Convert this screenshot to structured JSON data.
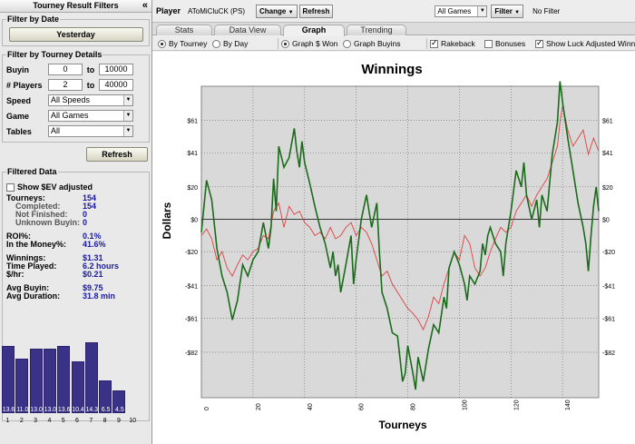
{
  "left": {
    "title": "Tourney Result Filters",
    "collapse_icon": "«",
    "filter_by_date": {
      "legend": "Filter by Date",
      "button": "Yesterday"
    },
    "filter_by_details": {
      "legend": "Filter by Tourney Details",
      "buyin": {
        "label": "Buyin",
        "from": "0",
        "to_word": "to",
        "to": "10000"
      },
      "players": {
        "label": "# Players",
        "from": "2",
        "to_word": "to",
        "to": "40000"
      },
      "speed": {
        "label": "Speed",
        "value": "All Speeds"
      },
      "game": {
        "label": "Game",
        "value": "All Games"
      },
      "tables": {
        "label": "Tables",
        "value": "All"
      }
    },
    "refresh_button": "Refresh",
    "filtered": {
      "legend": "Filtered Data",
      "show_sev": "Show $EV adjusted",
      "tourneys": {
        "label": "Tourneys:",
        "value": "154"
      },
      "completed": {
        "label": "Completed:",
        "value": "154"
      },
      "not_finished": {
        "label": "Not Finished:",
        "value": "0"
      },
      "unknown_buyin": {
        "label": "Unknown Buyin:",
        "value": "0"
      },
      "roi": {
        "label": "ROI%:",
        "value": "0.1%"
      },
      "itm": {
        "label": "In the Money%:",
        "value": "41.6%"
      },
      "winnings": {
        "label": "Winnings:",
        "value": "$1.31"
      },
      "time_played": {
        "label": "Time Played:",
        "value": "6.2 hours"
      },
      "per_hr": {
        "label": "$/hr:",
        "value": "$0.21"
      },
      "avg_buyin": {
        "label": "Avg Buyin:",
        "value": "$9.75"
      },
      "avg_duration": {
        "label": "Avg Duration:",
        "value": "31.8 min"
      }
    },
    "histogram": {
      "values": [
        13.6,
        11.0,
        13.0,
        13.0,
        13.6,
        10.4,
        14.3,
        6.5,
        4.5
      ],
      "labels": [
        "13.6",
        "11.0",
        "13.0",
        "13.0",
        "13.6",
        "10.4",
        "14.3",
        "6.5",
        "4.5"
      ],
      "x_ticks": [
        "1",
        "2",
        "3",
        "4",
        "5",
        "6",
        "7",
        "8",
        "9",
        "10"
      ],
      "bar_color": "#3a3286"
    }
  },
  "toolbar": {
    "player_label": "Player",
    "player_name": "AToMiCluCK (PS)",
    "change_button": "Change",
    "refresh_button": "Refresh",
    "games_select": "All Games",
    "filter_button": "Filter",
    "filter_status": "No Filter"
  },
  "tabs": [
    "Stats",
    "Data View",
    "Graph",
    "Trending"
  ],
  "options": {
    "by_tourney": "By Tourney",
    "by_day": "By Day",
    "graph_won": "Graph $ Won",
    "graph_buyins": "Graph Buyins",
    "rakeback": "Rakeback",
    "bonuses": "Bonuses",
    "show_luck": "Show Luck Adjusted Winn"
  },
  "chart_data": {
    "type": "line",
    "title": "Winnings",
    "xlabel": "Tourneys",
    "ylabel": "Dollars",
    "xlim": [
      0,
      154
    ],
    "ylim": [
      -110,
      82
    ],
    "x_ticks": [
      0,
      20,
      40,
      60,
      80,
      100,
      120,
      140
    ],
    "y_ticks": [
      61,
      41,
      20,
      0,
      -20,
      -41,
      -61,
      -82
    ],
    "y_tick_labels": [
      "$61",
      "$41",
      "$20",
      "$0",
      "-$20",
      "-$41",
      "-$61",
      "-$82"
    ],
    "grid": true,
    "series": [
      {
        "color": "#1a6b1a",
        "points": [
          [
            0,
            -8
          ],
          [
            2,
            24
          ],
          [
            4,
            12
          ],
          [
            6,
            -18
          ],
          [
            8,
            -35
          ],
          [
            10,
            -45
          ],
          [
            12,
            -62
          ],
          [
            14,
            -50
          ],
          [
            16,
            -28
          ],
          [
            18,
            -35
          ],
          [
            20,
            -25
          ],
          [
            22,
            -20
          ],
          [
            24,
            -2
          ],
          [
            26,
            -18
          ],
          [
            27,
            -5
          ],
          [
            28,
            25
          ],
          [
            29,
            5
          ],
          [
            30,
            45
          ],
          [
            32,
            32
          ],
          [
            34,
            38
          ],
          [
            36,
            56
          ],
          [
            37,
            42
          ],
          [
            38,
            32
          ],
          [
            39,
            48
          ],
          [
            40,
            35
          ],
          [
            42,
            22
          ],
          [
            44,
            8
          ],
          [
            46,
            -5
          ],
          [
            48,
            -15
          ],
          [
            50,
            -30
          ],
          [
            51,
            -20
          ],
          [
            52,
            -35
          ],
          [
            53,
            -28
          ],
          [
            54,
            -45
          ],
          [
            56,
            -28
          ],
          [
            58,
            -10
          ],
          [
            59,
            -40
          ],
          [
            60,
            -25
          ],
          [
            62,
            0
          ],
          [
            64,
            15
          ],
          [
            66,
            -5
          ],
          [
            68,
            10
          ],
          [
            69,
            -20
          ],
          [
            70,
            -45
          ],
          [
            72,
            -55
          ],
          [
            74,
            -70
          ],
          [
            76,
            -72
          ],
          [
            78,
            -100
          ],
          [
            79,
            -95
          ],
          [
            80,
            -78
          ],
          [
            82,
            -95
          ],
          [
            83,
            -105
          ],
          [
            84,
            -85
          ],
          [
            86,
            -100
          ],
          [
            88,
            -80
          ],
          [
            90,
            -65
          ],
          [
            92,
            -70
          ],
          [
            94,
            -48
          ],
          [
            95,
            -55
          ],
          [
            96,
            -30
          ],
          [
            98,
            -20
          ],
          [
            100,
            -28
          ],
          [
            102,
            -40
          ],
          [
            103,
            -50
          ],
          [
            104,
            -35
          ],
          [
            106,
            -40
          ],
          [
            108,
            -32
          ],
          [
            109,
            -15
          ],
          [
            110,
            -22
          ],
          [
            111,
            -10
          ],
          [
            112,
            -5
          ],
          [
            114,
            -15
          ],
          [
            116,
            -20
          ],
          [
            117,
            -35
          ],
          [
            118,
            -15
          ],
          [
            120,
            5
          ],
          [
            122,
            30
          ],
          [
            124,
            20
          ],
          [
            125,
            35
          ],
          [
            126,
            15
          ],
          [
            128,
            0
          ],
          [
            130,
            12
          ],
          [
            131,
            -5
          ],
          [
            132,
            15
          ],
          [
            134,
            5
          ],
          [
            136,
            40
          ],
          [
            138,
            60
          ],
          [
            139,
            85
          ],
          [
            140,
            72
          ],
          [
            142,
            50
          ],
          [
            144,
            30
          ],
          [
            146,
            10
          ],
          [
            148,
            -5
          ],
          [
            149,
            -15
          ],
          [
            150,
            -32
          ],
          [
            151,
            -10
          ],
          [
            152,
            8
          ],
          [
            153,
            20
          ],
          [
            154,
            5
          ]
        ]
      },
      {
        "color": "#e04040",
        "points": [
          [
            0,
            -10
          ],
          [
            2,
            -6
          ],
          [
            4,
            -12
          ],
          [
            6,
            -25
          ],
          [
            8,
            -20
          ],
          [
            10,
            -30
          ],
          [
            12,
            -35
          ],
          [
            14,
            -28
          ],
          [
            16,
            -22
          ],
          [
            18,
            -25
          ],
          [
            20,
            -20
          ],
          [
            22,
            -18
          ],
          [
            24,
            -10
          ],
          [
            26,
            -12
          ],
          [
            28,
            5
          ],
          [
            30,
            10
          ],
          [
            32,
            -5
          ],
          [
            34,
            8
          ],
          [
            36,
            3
          ],
          [
            38,
            5
          ],
          [
            40,
            -2
          ],
          [
            42,
            -5
          ],
          [
            44,
            -10
          ],
          [
            46,
            -8
          ],
          [
            48,
            -12
          ],
          [
            50,
            -5
          ],
          [
            52,
            -12
          ],
          [
            54,
            -10
          ],
          [
            56,
            -5
          ],
          [
            58,
            -2
          ],
          [
            60,
            -10
          ],
          [
            62,
            -5
          ],
          [
            64,
            -8
          ],
          [
            66,
            -15
          ],
          [
            68,
            -25
          ],
          [
            70,
            -35
          ],
          [
            72,
            -32
          ],
          [
            74,
            -40
          ],
          [
            76,
            -45
          ],
          [
            78,
            -50
          ],
          [
            80,
            -55
          ],
          [
            82,
            -58
          ],
          [
            84,
            -62
          ],
          [
            86,
            -68
          ],
          [
            88,
            -60
          ],
          [
            90,
            -48
          ],
          [
            92,
            -52
          ],
          [
            94,
            -40
          ],
          [
            96,
            -30
          ],
          [
            98,
            -20
          ],
          [
            100,
            -25
          ],
          [
            102,
            -10
          ],
          [
            104,
            -15
          ],
          [
            106,
            -30
          ],
          [
            108,
            -35
          ],
          [
            110,
            -30
          ],
          [
            112,
            -20
          ],
          [
            114,
            -12
          ],
          [
            116,
            -5
          ],
          [
            118,
            -8
          ],
          [
            120,
            -5
          ],
          [
            122,
            5
          ],
          [
            124,
            10
          ],
          [
            126,
            15
          ],
          [
            128,
            8
          ],
          [
            130,
            15
          ],
          [
            132,
            20
          ],
          [
            134,
            25
          ],
          [
            136,
            35
          ],
          [
            138,
            45
          ],
          [
            139,
            60
          ],
          [
            140,
            70
          ],
          [
            142,
            55
          ],
          [
            144,
            45
          ],
          [
            146,
            50
          ],
          [
            148,
            55
          ],
          [
            150,
            40
          ],
          [
            152,
            50
          ],
          [
            154,
            42
          ]
        ]
      }
    ]
  }
}
